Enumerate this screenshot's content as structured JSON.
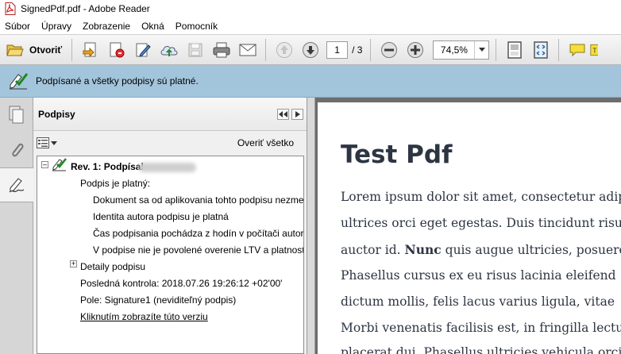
{
  "window": {
    "title": "SignedPdf.pdf - Adobe Reader"
  },
  "menu": [
    "Súbor",
    "Úpravy",
    "Zobrazenie",
    "Okná",
    "Pomocník"
  ],
  "toolbar": {
    "open_label": "Otvoriť",
    "current_page": "1",
    "total_pages": "/ 3",
    "zoom": "74,5%"
  },
  "signature_bar": {
    "message": "Podpísané a všetky podpisy sú platné."
  },
  "panel": {
    "title": "Podpisy",
    "verify_all": "Overiť všetko",
    "signature": {
      "revision_label": "Rev. 1: Podpísal",
      "valid_label": "Podpis je platný:",
      "details": [
        "Dokument sa od aplikovania tohto podpisu nezmenil",
        "Identita autora podpisu je platná",
        "Čas podpisania pochádza z hodín v počítači autora podpisu.",
        "V podpise nie je povolené overenie LTV a platnosť podpisu vypršala"
      ],
      "details_node": "Detaily podpisu",
      "last_check": "Posledná kontrola: 2018.07.26 19:26:12 +02'00'",
      "field": "Pole: Signature1 (neviditeľný podpis)",
      "view_version_link": "Kliknutím zobrazíte túto verziu"
    }
  },
  "document": {
    "title": "Test Pdf",
    "lines": [
      "Lorem ipsum dolor sit amet, consectetur adipiscing elit.",
      "ultrices orci eget egestas. Duis tincidunt risus",
      "quis augue ultricies, posuere",
      "Phasellus cursus ex eu risus lacinia eleifend",
      "dictum mollis, felis lacus varius ligula, vitae",
      "Morbi venenatis facilisis est, in fringilla lectus",
      "placerat dui. Phasellus ultricies vehicula orci"
    ],
    "line3_prefix": "auctor id. ",
    "line3_bold": "Nunc"
  },
  "colors": {
    "signature_bar": "#a3c5dc",
    "document_text": "#2d3542",
    "doc_background": "#6d6d6d"
  },
  "icons": [
    "pdf-file-icon",
    "folder-open-icon",
    "create-pdf-icon",
    "edit-pdf-icon",
    "sign-icon",
    "upload-cloud-icon",
    "save-icon",
    "print-icon",
    "email-icon",
    "page-up-icon",
    "page-down-icon",
    "zoom-out-icon",
    "zoom-in-icon",
    "fit-page-icon",
    "fit-width-icon",
    "comment-icon",
    "signature-valid-icon",
    "pages-icon",
    "attachment-icon",
    "signatures-icon"
  ]
}
